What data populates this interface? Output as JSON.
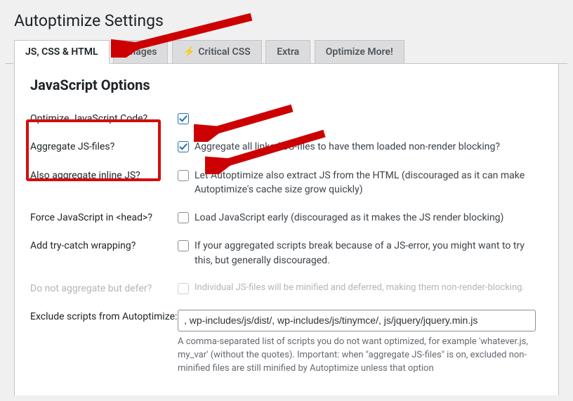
{
  "page_title": "Autoptimize Settings",
  "tabs": [
    {
      "label": "JS, CSS & HTML",
      "active": true
    },
    {
      "label": "Images",
      "active": false
    },
    {
      "label": "Critical CSS",
      "active": false,
      "has_icon": true
    },
    {
      "label": "Extra",
      "active": false
    },
    {
      "label": "Optimize More!",
      "active": false
    }
  ],
  "section_title": "JavaScript Options",
  "rows": {
    "optimize_js": {
      "label": "Optimize JavaScript Code?",
      "checked": true,
      "desc": ""
    },
    "aggregate_js": {
      "label": "Aggregate JS-files?",
      "checked": true,
      "desc": "Aggregate all linked JS-files to have them loaded non-render blocking?"
    },
    "inline_js": {
      "label": "Also aggregate inline JS?",
      "checked": false,
      "desc": "Let Autoptimize also extract JS from the HTML (discouraged as it can make Autoptimize's cache size grow quickly)"
    },
    "force_head": {
      "label": "Force JavaScript in <head>?",
      "checked": false,
      "desc": "Load JavaScript early (discouraged as it makes the JS render blocking)"
    },
    "try_catch": {
      "label": "Add try-catch wrapping?",
      "checked": false,
      "desc": "If your aggregated scripts break because of a JS-error, you might want to try this, but generally discouraged."
    },
    "defer_js": {
      "label": "Do not aggregate but defer?",
      "checked": false,
      "disabled": true,
      "desc": "Individual JS-files will be minified and deferred, making them non-render-blocking."
    },
    "exclude": {
      "label": "Exclude scripts from Autoptimize:",
      "value": ", wp-includes/js/dist/, wp-includes/js/tinymce/, js/jquery/jquery.min.js",
      "desc": "A comma-separated list of scripts you do not want optimized, for example 'whatever.js, my_var' (without the quotes). Important: when \"aggregate JS-files\" is on, excluded non-minified files are still minified by Autoptimize unless that option"
    }
  }
}
